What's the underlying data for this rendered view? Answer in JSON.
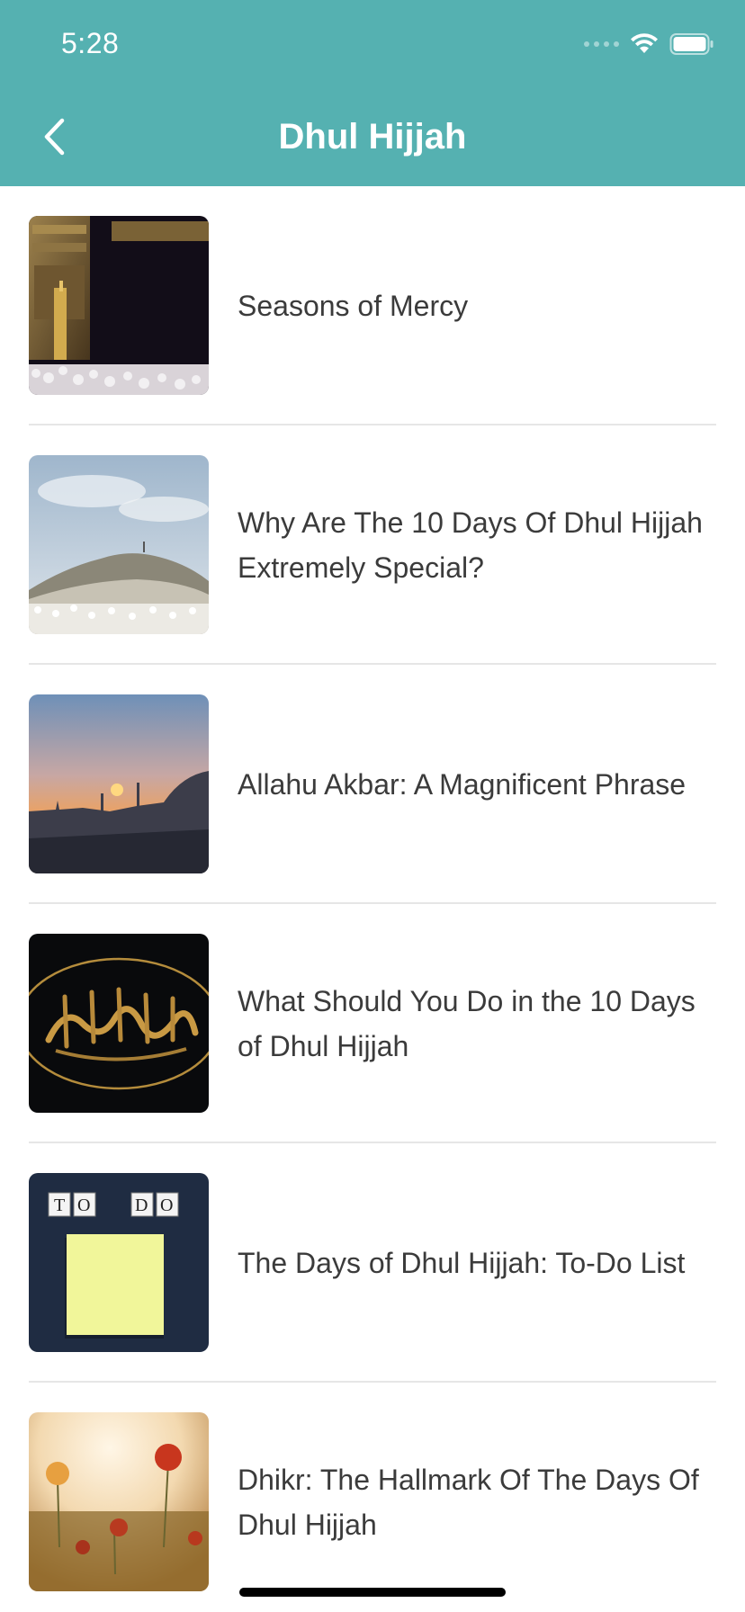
{
  "status_bar": {
    "time": "5:28",
    "icons": [
      "signal-icon",
      "wifi-icon",
      "battery-icon"
    ]
  },
  "nav": {
    "title": "Dhul Hijjah",
    "back_icon": "chevron-left-icon"
  },
  "colors": {
    "header": "#55b1b1",
    "divider": "#e6e6e6",
    "text": "#3b3b3b"
  },
  "articles": [
    {
      "title": "Seasons of Mercy",
      "thumbnail": "kaaba-image"
    },
    {
      "title": "Why Are The 10 Days Of Dhul Hijjah Extremely Special?",
      "thumbnail": "mount-arafat-crowd-image"
    },
    {
      "title": "Allahu Akbar: A Magnificent Phrase",
      "thumbnail": "sunset-mosque-skyline-image"
    },
    {
      "title": "What Should You Do in the 10 Days of Dhul Hijjah",
      "thumbnail": "allahu-akbar-calligraphy-image"
    },
    {
      "title": "The Days of Dhul Hijjah: To-Do List",
      "thumbnail": "to-do-sticky-note-image"
    },
    {
      "title": "Dhikr: The Hallmark Of The Days Of Dhul Hijjah",
      "thumbnail": "poppy-field-image"
    }
  ]
}
